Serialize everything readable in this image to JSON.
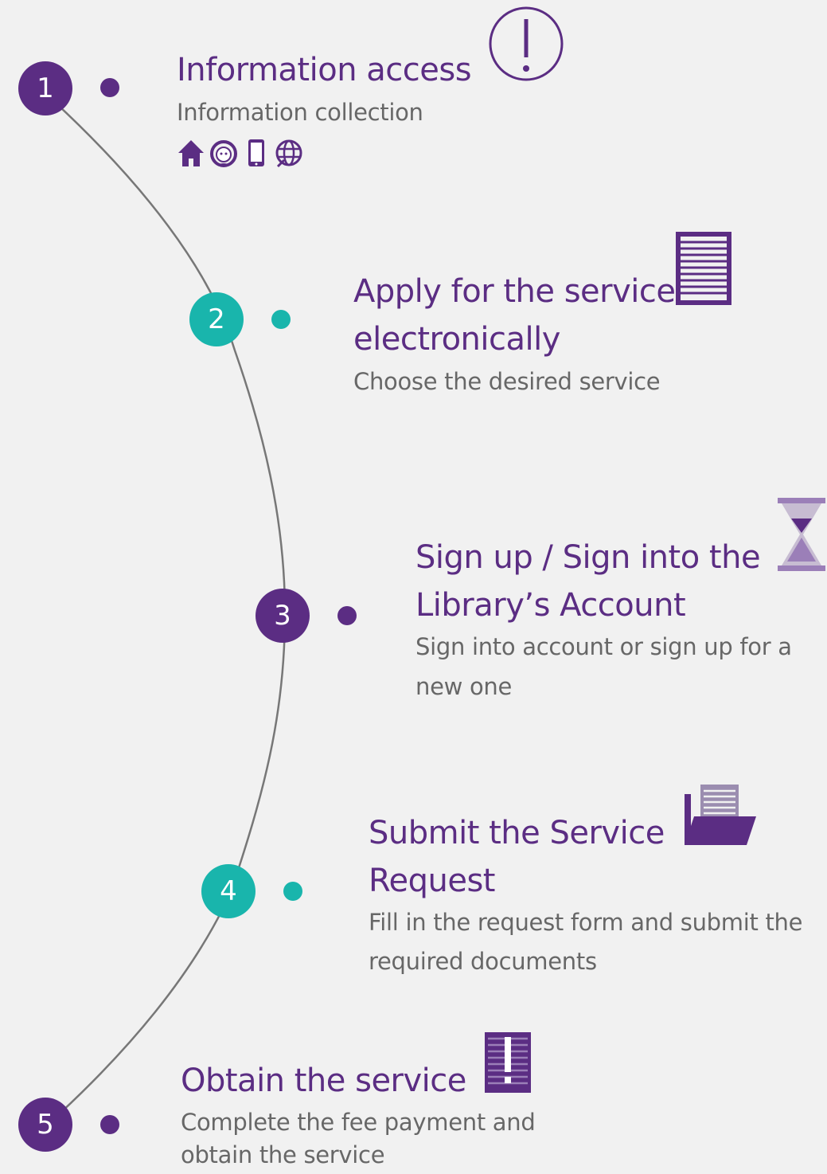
{
  "colors": {
    "primary": "#5b2d83",
    "accent": "#19b5ac",
    "text": "#676767",
    "background": "#f1f1f1"
  },
  "steps": [
    {
      "number": "1",
      "title": "Information access",
      "description": "Information collection",
      "icon": "exclamation-circle-icon",
      "color": "#5b2d83"
    },
    {
      "number": "2",
      "title_line1": "Apply for the service",
      "title_line2": "electronically",
      "description": "Choose the desired service",
      "icon": "document-list-icon",
      "color": "#19b5ac"
    },
    {
      "number": "3",
      "title_line1": "Sign up / Sign into the",
      "title_line2": "Library’s Account",
      "description_line1": "Sign into account or sign up for a",
      "description_line2": "new one",
      "icon": "hourglass-icon",
      "color": "#5b2d83"
    },
    {
      "number": "4",
      "title_line1": "Submit the Service",
      "title_line2": "Request",
      "description_line1": "Fill in the request form and submit the",
      "description_line2": "required documents",
      "icon": "folder-document-icon",
      "color": "#19b5ac"
    },
    {
      "number": "5",
      "title": "Obtain the service",
      "description_line1": "Complete the fee payment and",
      "description_line2": "obtain the service",
      "icon": "exclamation-document-icon",
      "color": "#5b2d83"
    }
  ],
  "channel_icons": [
    "home-icon",
    "support-agent-icon",
    "mobile-icon",
    "web-icon"
  ]
}
